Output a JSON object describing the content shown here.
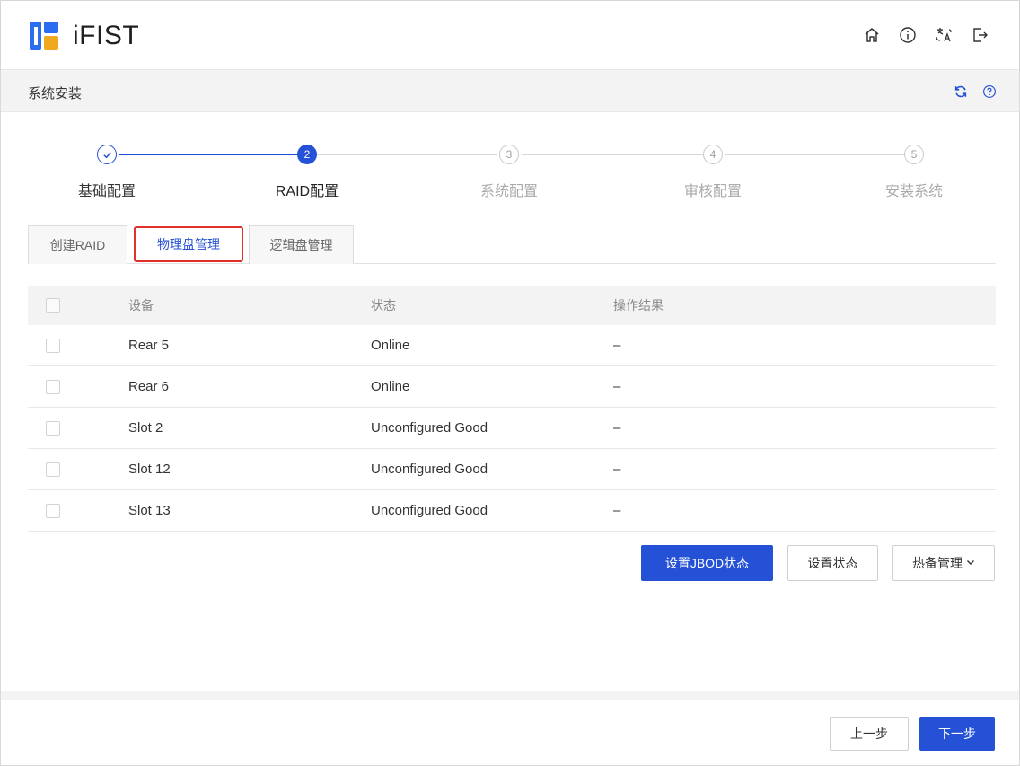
{
  "app": {
    "name": "iFIST"
  },
  "header": {
    "icons": [
      "home-icon",
      "info-icon",
      "language-icon",
      "logout-icon"
    ]
  },
  "section": {
    "title": "系统安装",
    "tools": [
      "refresh-icon",
      "help-icon"
    ]
  },
  "steps": [
    {
      "label": "基础配置",
      "num": "1",
      "state": "done"
    },
    {
      "label": "RAID配置",
      "num": "2",
      "state": "active"
    },
    {
      "label": "系统配置",
      "num": "3",
      "state": "todo"
    },
    {
      "label": "审核配置",
      "num": "4",
      "state": "todo"
    },
    {
      "label": "安装系统",
      "num": "5",
      "state": "todo"
    }
  ],
  "tabs": [
    {
      "label": "创建RAID"
    },
    {
      "label": "物理盘管理",
      "active": true
    },
    {
      "label": "逻辑盘管理"
    }
  ],
  "table": {
    "columns": {
      "device": "设备",
      "status": "状态",
      "result": "操作结果"
    },
    "rows": [
      {
        "device": "Rear 5",
        "status": "Online",
        "result": "–"
      },
      {
        "device": "Rear 6",
        "status": "Online",
        "result": "–"
      },
      {
        "device": "Slot 2",
        "status": "Unconfigured Good",
        "result": "–"
      },
      {
        "device": "Slot 12",
        "status": "Unconfigured Good",
        "result": "–"
      },
      {
        "device": "Slot 13",
        "status": "Unconfigured Good",
        "result": "–"
      }
    ]
  },
  "actions": {
    "set_jbod": "设置JBOD状态",
    "set_state": "设置状态",
    "hot_spare": "热备管理"
  },
  "footer": {
    "prev": "上一步",
    "next": "下一步"
  },
  "colors": {
    "primary": "#2451d5",
    "highlight": "#e0322b"
  }
}
